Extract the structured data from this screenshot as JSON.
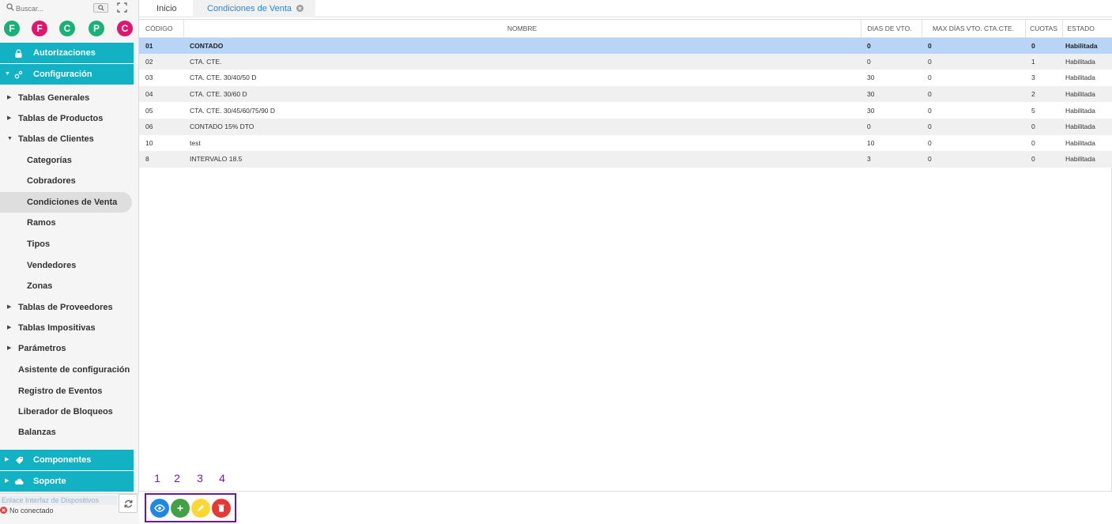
{
  "search": {
    "placeholder": "Buscar..."
  },
  "avatars": [
    {
      "letter": "F",
      "color": "#1ab07a"
    },
    {
      "letter": "F",
      "color": "#e0156f"
    },
    {
      "letter": "C",
      "color": "#1ab07a"
    },
    {
      "letter": "P",
      "color": "#1ab07a"
    },
    {
      "letter": "C",
      "color": "#e0156f"
    }
  ],
  "sidebar": {
    "autorizaciones": "Autorizaciones",
    "configuracion": "Configuración",
    "tablas_generales": "Tablas Generales",
    "tablas_productos": "Tablas de Productos",
    "tablas_clientes": "Tablas de Clientes",
    "clientes_items": [
      "Categorías",
      "Cobradores",
      "Condiciones de Venta",
      "Ramos",
      "Tipos",
      "Vendedores",
      "Zonas"
    ],
    "tablas_proveedores": "Tablas de Proveedores",
    "tablas_impositivas": "Tablas Impositivas",
    "parametros": "Parámetros",
    "asistente": "Asistente de configuración",
    "registro": "Registro de Eventos",
    "liberador": "Liberador de Bloqueos",
    "balanzas": "Balanzas",
    "componentes": "Componentes",
    "soporte": "Soporte",
    "device_label": "Enlace Interfaz de Dispositivos",
    "device_status": "No conectado"
  },
  "tabs": {
    "inicio": "Inicio",
    "condiciones": "Condiciones de Venta"
  },
  "table": {
    "headers": [
      "CÓDIGO",
      "NOMBRE",
      "DIAS DE VTO.",
      "MAX DÍAS VTO. CTA.CTE.",
      "CUOTAS",
      "ESTADO"
    ],
    "rows": [
      [
        "01",
        "CONTADO",
        "0",
        "0",
        "0",
        "Habilitada"
      ],
      [
        "02",
        "CTA. CTE.",
        "0",
        "0",
        "1",
        "Habilitada"
      ],
      [
        "03",
        "CTA. CTE. 30/40/50 D",
        "30",
        "0",
        "3",
        "Habilitada"
      ],
      [
        "04",
        "CTA. CTE. 30/60 D",
        "30",
        "0",
        "2",
        "Habilitada"
      ],
      [
        "05",
        "CTA. CTE. 30/45/60/75/90 D",
        "30",
        "0",
        "5",
        "Habilitada"
      ],
      [
        "06",
        "CONTADO 15% DTO",
        "0",
        "0",
        "0",
        "Habilitada"
      ],
      [
        "10",
        "test",
        "10",
        "0",
        "0",
        "Habilitada"
      ],
      [
        "8",
        "INTERVALO 18.5",
        "3",
        "0",
        "0",
        "Habilitada"
      ]
    ],
    "selected_index": 0
  },
  "actions": {
    "step_labels": [
      "1",
      "2",
      "3",
      "4"
    ],
    "buttons": [
      {
        "name": "view",
        "icon": "eye-icon",
        "color": "#1e88e5"
      },
      {
        "name": "add",
        "icon": "plus-icon",
        "color": "#43a047"
      },
      {
        "name": "edit",
        "icon": "pencil-icon",
        "color": "#fdd835"
      },
      {
        "name": "delete",
        "icon": "trash-icon",
        "color": "#e53935"
      }
    ]
  },
  "colors": {
    "teal": "#12b2c4",
    "selected_row": "#b8d4f7",
    "active_tab": "#1e88e5",
    "frame": "#6a1b9a"
  }
}
